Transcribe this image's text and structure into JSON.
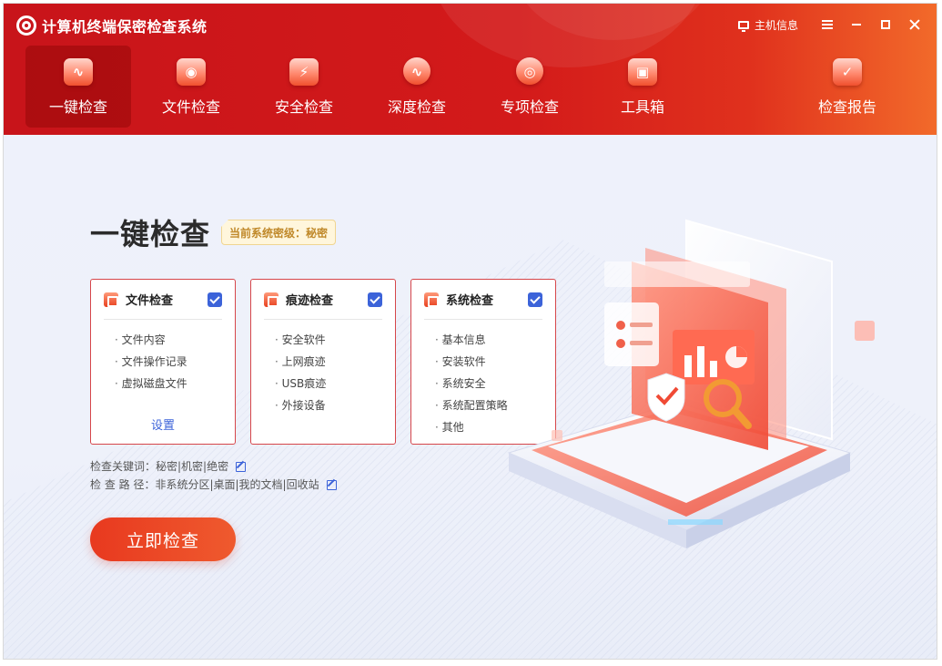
{
  "app": {
    "title": "计算机终端保密检查系统"
  },
  "window_controls": {
    "host_info_label": "主机信息"
  },
  "nav": {
    "items": [
      {
        "label": "一键检查",
        "icon": "one-click-check-icon",
        "active": true
      },
      {
        "label": "文件检查",
        "icon": "file-check-icon",
        "active": false
      },
      {
        "label": "安全检查",
        "icon": "security-check-icon",
        "active": false
      },
      {
        "label": "深度检查",
        "icon": "deep-check-icon",
        "active": false
      },
      {
        "label": "专项检查",
        "icon": "special-check-icon",
        "active": false
      },
      {
        "label": "工具箱",
        "icon": "toolbox-icon",
        "active": false
      }
    ],
    "report_label": "检查报告"
  },
  "main": {
    "title": "一键检查",
    "security_level_badge": "当前系统密级：秘密",
    "cards": [
      {
        "title": "文件检查",
        "checked": true,
        "items": [
          "文件内容",
          "文件操作记录",
          "虚拟磁盘文件"
        ],
        "settings_label": "设置"
      },
      {
        "title": "痕迹检查",
        "checked": true,
        "items": [
          "安全软件",
          "上网痕迹",
          "USB痕迹",
          "外接设备"
        ]
      },
      {
        "title": "系统检查",
        "checked": true,
        "items": [
          "基本信息",
          "安装软件",
          "系统安全",
          "系统配置策略",
          "其他"
        ]
      }
    ],
    "keywords_label": "检查关键词：秘密|机密|绝密",
    "path_label": "检 查 路 径：非系统分区|桌面|我的文档|回收站",
    "start_button": "立即检查"
  },
  "colors": {
    "brand_red": "#c8141a",
    "accent_orange": "#ef5a2e",
    "check_blue": "#3c63d9"
  }
}
